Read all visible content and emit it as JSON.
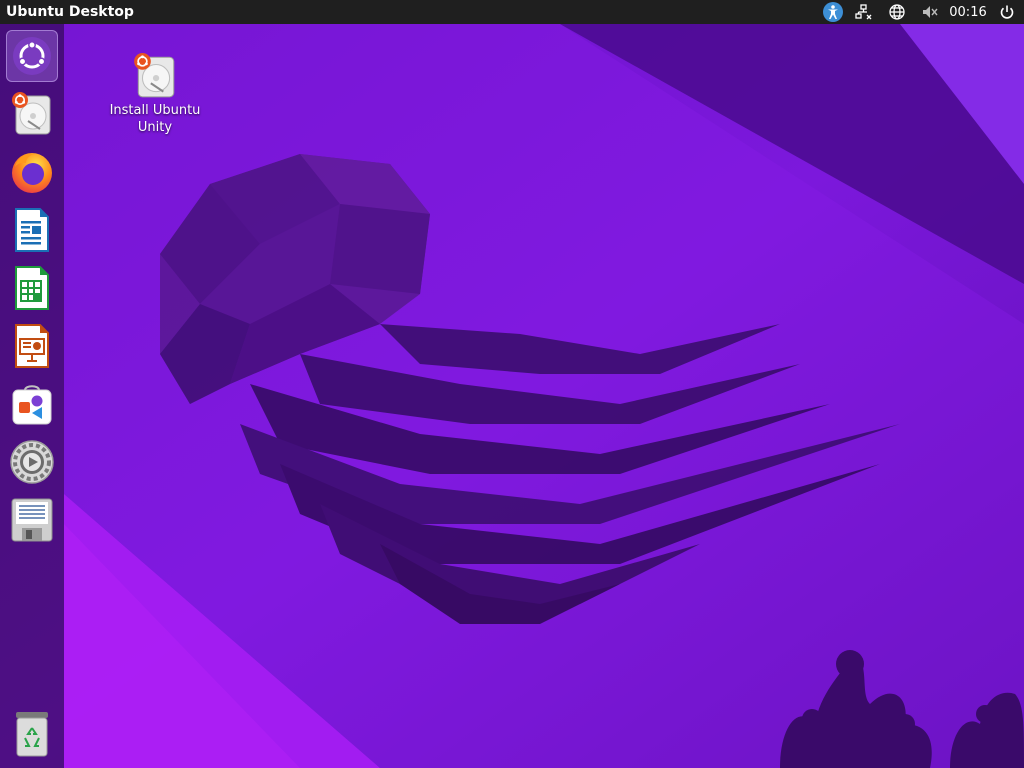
{
  "top_panel": {
    "title": "Ubuntu Desktop",
    "clock": "00:16",
    "indicators": [
      "accessibility-icon",
      "network-icon",
      "keyboard-layout-icon",
      "volume-muted-icon",
      "power-icon"
    ]
  },
  "launcher": {
    "items": [
      {
        "name": "ubuntu-dash",
        "icon": "ubuntu-logo-icon"
      },
      {
        "name": "install-ubuntu-unity",
        "icon": "installer-disk-icon"
      },
      {
        "name": "firefox",
        "icon": "firefox-icon"
      },
      {
        "name": "libreoffice-writer",
        "icon": "writer-document-icon"
      },
      {
        "name": "libreoffice-calc",
        "icon": "calc-spreadsheet-icon"
      },
      {
        "name": "libreoffice-impress",
        "icon": "impress-presentation-icon"
      },
      {
        "name": "app-center",
        "icon": "app-store-icon"
      },
      {
        "name": "system-settings",
        "icon": "settings-gear-icon"
      },
      {
        "name": "text-editor",
        "icon": "text-editor-icon"
      },
      {
        "name": "trash",
        "icon": "trash-icon"
      }
    ]
  },
  "desktop": {
    "icons": [
      {
        "label": "Install Ubuntu Unity",
        "icon": "installer-disk-icon"
      }
    ]
  },
  "colors": {
    "panel": "#1f1f1f",
    "wallpaper_base": "#7a16d8",
    "accent_orange": "#e95420"
  }
}
